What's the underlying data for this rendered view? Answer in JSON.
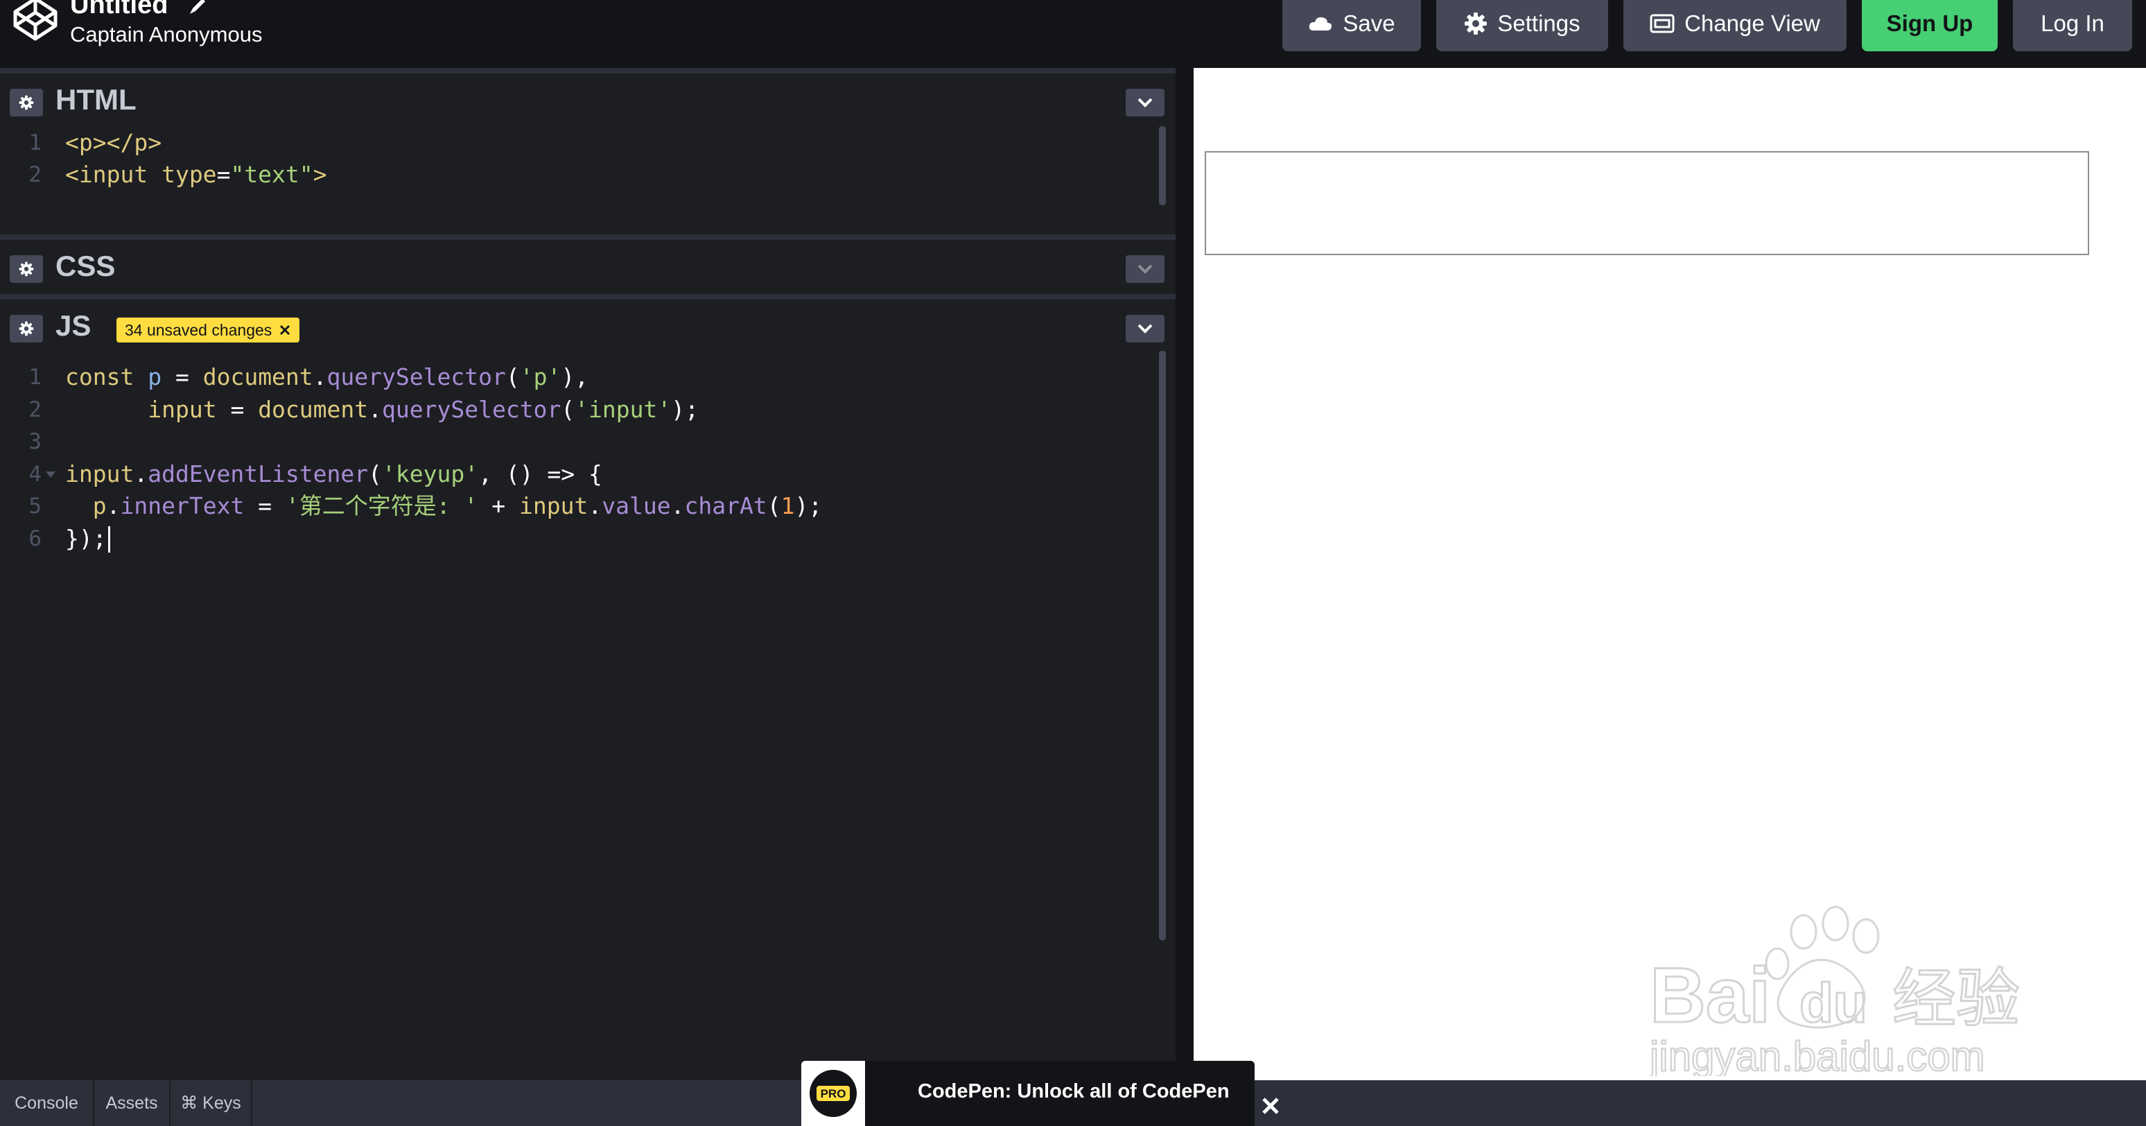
{
  "header": {
    "title": "Untitled",
    "author": "Captain Anonymous",
    "buttons": {
      "save": "Save",
      "settings": "Settings",
      "change_view": "Change View",
      "sign_up": "Sign Up",
      "log_in": "Log In"
    },
    "colors": {
      "sign_up": "#47cf73",
      "button": "#444857"
    }
  },
  "editors": {
    "html": {
      "title": "HTML",
      "lines": [
        {
          "num": "1",
          "tokens": [
            {
              "t": "<p></p>",
              "c": "tag"
            }
          ]
        },
        {
          "num": "2",
          "tokens": [
            {
              "t": "<input ",
              "c": "tag"
            },
            {
              "t": "type",
              "c": "attr"
            },
            {
              "t": "=",
              "c": "punct"
            },
            {
              "t": "\"text\"",
              "c": "str"
            },
            {
              "t": ">",
              "c": "tag"
            }
          ]
        }
      ]
    },
    "css": {
      "title": "CSS"
    },
    "js": {
      "title": "JS",
      "badge": "34 unsaved changes",
      "lines": [
        {
          "num": "1",
          "indent": "",
          "tokens": [
            {
              "t": "const ",
              "c": "kw"
            },
            {
              "t": "p ",
              "c": "fn"
            },
            {
              "t": "= ",
              "c": "punct"
            },
            {
              "t": "document",
              "c": "kw"
            },
            {
              "t": ".",
              "c": "punct"
            },
            {
              "t": "querySelector",
              "c": "prop"
            },
            {
              "t": "(",
              "c": "punct"
            },
            {
              "t": "'p'",
              "c": "str"
            },
            {
              "t": "),",
              "c": "punct"
            }
          ]
        },
        {
          "num": "2",
          "indent": "      ",
          "tokens": [
            {
              "t": "input ",
              "c": "kw"
            },
            {
              "t": "= ",
              "c": "punct"
            },
            {
              "t": "document",
              "c": "kw"
            },
            {
              "t": ".",
              "c": "punct"
            },
            {
              "t": "querySelector",
              "c": "prop"
            },
            {
              "t": "(",
              "c": "punct"
            },
            {
              "t": "'input'",
              "c": "str"
            },
            {
              "t": ");",
              "c": "punct"
            }
          ]
        },
        {
          "num": "3",
          "indent": "",
          "tokens": []
        },
        {
          "num": "4",
          "indent": "",
          "fold": true,
          "tokens": [
            {
              "t": "input",
              "c": "kw"
            },
            {
              "t": ".",
              "c": "punct"
            },
            {
              "t": "addEventListener",
              "c": "prop"
            },
            {
              "t": "(",
              "c": "punct"
            },
            {
              "t": "'keyup'",
              "c": "str"
            },
            {
              "t": ", () => {",
              "c": "punct"
            }
          ]
        },
        {
          "num": "5",
          "indent": "  ",
          "tokens": [
            {
              "t": "p",
              "c": "kw"
            },
            {
              "t": ".",
              "c": "punct"
            },
            {
              "t": "innerText ",
              "c": "prop"
            },
            {
              "t": "= ",
              "c": "punct"
            },
            {
              "t": "'第二个字符是: '",
              "c": "str"
            },
            {
              "t": " + ",
              "c": "punct"
            },
            {
              "t": "input",
              "c": "kw"
            },
            {
              "t": ".",
              "c": "punct"
            },
            {
              "t": "value",
              "c": "prop"
            },
            {
              "t": ".",
              "c": "punct"
            },
            {
              "t": "charAt",
              "c": "prop"
            },
            {
              "t": "(",
              "c": "punct"
            },
            {
              "t": "1",
              "c": "num"
            },
            {
              "t": ");",
              "c": "punct"
            }
          ]
        },
        {
          "num": "6",
          "indent": "",
          "cursor": true,
          "tokens": [
            {
              "t": "});",
              "c": "punct"
            }
          ]
        }
      ]
    }
  },
  "bottom_bar": {
    "console": "Console",
    "assets": "Assets",
    "keys": "⌘ Keys"
  },
  "promo": {
    "badge": "PRO",
    "text": "CodePen: Unlock all of CodePen"
  },
  "watermark": {
    "brand": "Bai",
    "brand2": "du",
    "suffix": "经验",
    "url": "jingyan.baidu.com"
  }
}
